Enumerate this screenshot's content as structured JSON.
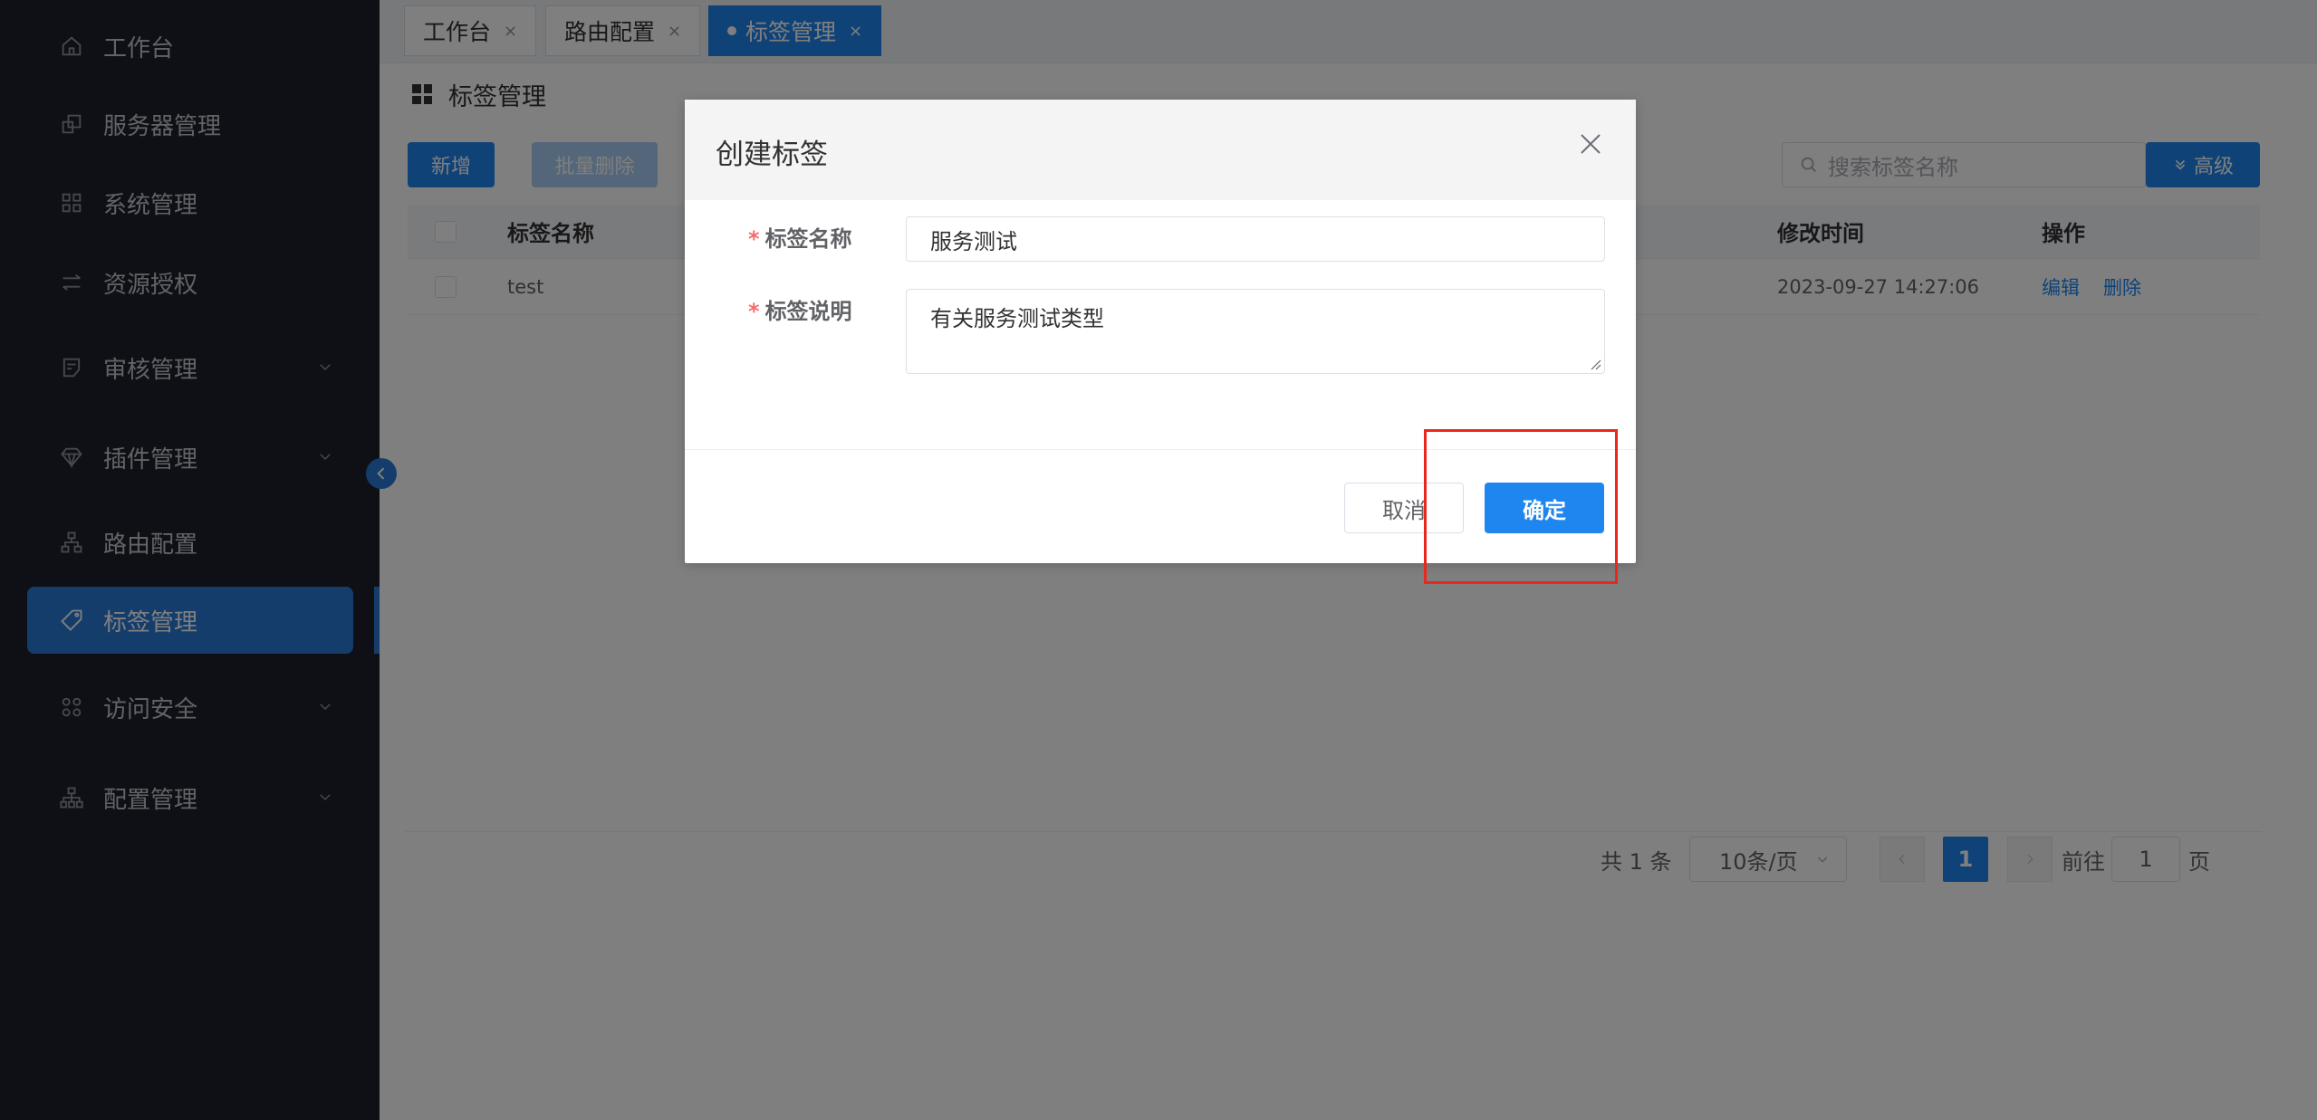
{
  "sidebar": {
    "items": [
      {
        "label": "工作台",
        "icon": "home-icon"
      },
      {
        "label": "服务器管理",
        "icon": "server-icon"
      },
      {
        "label": "系统管理",
        "icon": "grid-icon"
      },
      {
        "label": "资源授权",
        "icon": "transfer-icon"
      },
      {
        "label": "审核管理",
        "icon": "audit-icon"
      },
      {
        "label": "插件管理",
        "icon": "diamond-icon"
      },
      {
        "label": "路由配置",
        "icon": "route-icon"
      },
      {
        "label": "标签管理",
        "icon": "tag-icon"
      },
      {
        "label": "访问安全",
        "icon": "security-icon"
      },
      {
        "label": "配置管理",
        "icon": "config-icon"
      }
    ]
  },
  "tabs": [
    {
      "label": "工作台"
    },
    {
      "label": "路由配置"
    },
    {
      "label": "标签管理"
    }
  ],
  "page": {
    "title": "标签管理"
  },
  "toolbar": {
    "add_label": "新增",
    "batch_delete_label": "批量删除",
    "search_placeholder": "搜索标签名称",
    "advanced_label": "高级"
  },
  "table": {
    "columns": {
      "name": "标签名称",
      "modified": "修改时间",
      "actions": "操作"
    },
    "rows": [
      {
        "name": "test",
        "modified": "2023-09-27 14:27:06",
        "edit": "编辑",
        "delete": "删除"
      }
    ]
  },
  "pagination": {
    "total_text": "共 1 条",
    "page_size": "10条/页",
    "current_page": "1",
    "goto_prefix": "前往",
    "goto_value": "1",
    "goto_suffix": "页"
  },
  "dialog": {
    "title": "创建标签",
    "name_label": "标签名称",
    "name_value": "服务测试",
    "desc_label": "标签说明",
    "desc_value": "有关服务测试类型",
    "cancel_label": "取消",
    "confirm_label": "确定"
  },
  "colors": {
    "sidebar_bg": "#1c212c",
    "primary": "#1f86f0",
    "highlight": "#e8271f"
  }
}
